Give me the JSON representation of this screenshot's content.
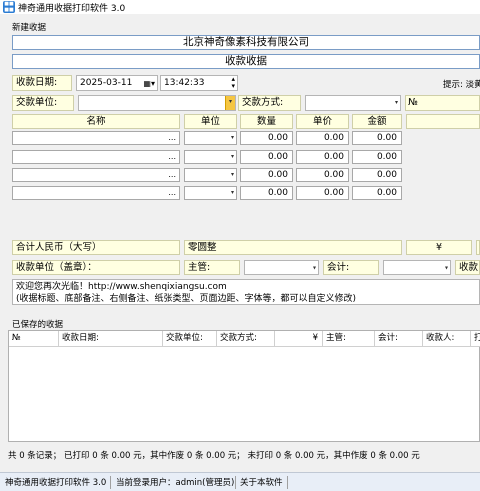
{
  "window": {
    "title": "神奇通用收据打印软件 3.0"
  },
  "new_receipt": {
    "group_label": "新建收据",
    "company": "北京神奇像素科技有限公司",
    "doc_title": "收款收据",
    "date_label": "收款日期:",
    "date_value": "2025-03-11",
    "time_value": "13:42:33",
    "hint": "提示: 淡黄",
    "payer_label": "交款单位:",
    "payer_value": "",
    "method_label": "交款方式:",
    "method_value": "",
    "no_label": "№",
    "no_value": "",
    "columns": [
      "名称",
      "单位",
      "数量",
      "单价",
      "金额"
    ],
    "rows": [
      {
        "name": "",
        "unit": "",
        "qty": "0.00",
        "price": "0.00",
        "amount": "0.00"
      },
      {
        "name": "",
        "unit": "",
        "qty": "0.00",
        "price": "0.00",
        "amount": "0.00"
      },
      {
        "name": "",
        "unit": "",
        "qty": "0.00",
        "price": "0.00",
        "amount": "0.00"
      },
      {
        "name": "",
        "unit": "",
        "qty": "0.00",
        "price": "0.00",
        "amount": "0.00"
      }
    ],
    "total_label": "合计人民币（大写）",
    "total_words": "零圆整",
    "yen_symbol": "¥",
    "seal_label": "收款单位（盖章）：",
    "supervisor_label": "主管:",
    "accountant_label": "会计:",
    "cashier_label": "收款",
    "footer_note_line1": "欢迎您再次光临！http://www.shenqixiangsu.com",
    "footer_note_line2": "(收据标题、底部备注、右侧备注、纸张类型、页面边距、字体等，都可以自定义修改)"
  },
  "saved": {
    "group_label": "已保存的收据",
    "columns": [
      "№",
      "收款日期:",
      "交款单位:",
      "交款方式:",
      "¥",
      "主管:",
      "会计:",
      "收款人:",
      "打印"
    ]
  },
  "summary": {
    "text": "共 0 条记录；   已打印 0 条 0.00 元，其中作废 0 条 0.00 元；   未打印 0 条 0.00 元，其中作废 0 条 0.00 元"
  },
  "statusbar": {
    "app": "神奇通用收据打印软件 3.0",
    "user": "当前登录用户：admin(管理员)",
    "about": "关于本软件"
  },
  "colors": {
    "label_bg": "#ffffe1",
    "accent": "#2b7cd3",
    "dropdown_accent": "#f5c642"
  }
}
